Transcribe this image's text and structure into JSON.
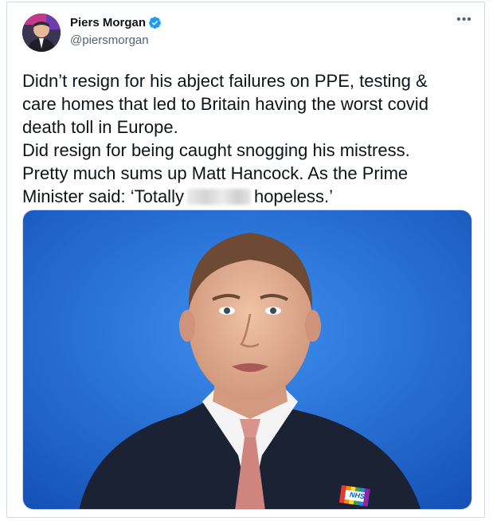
{
  "author": {
    "name": "Piers Morgan",
    "handle": "@piersmorgan",
    "verified": true
  },
  "menu_icon": "more-horizontal-icon",
  "tweet": {
    "lines": [
      "Didn’t resign for his abject failures on PPE, testing &",
      "care homes that led to Britain having the worst covid",
      "death toll in Europe.",
      "Did resign for being caught snogging his mistress.",
      "Pretty much sums up Matt Hancock. As the Prime",
      "Minister said: ‘Totally",
      "hopeless.’"
    ]
  },
  "media": {
    "badge_text": "NHS"
  },
  "colors": {
    "verified_blue": "#1d9bf0",
    "background_blue": "#1f6fd6",
    "handle_gray": "#536471"
  }
}
